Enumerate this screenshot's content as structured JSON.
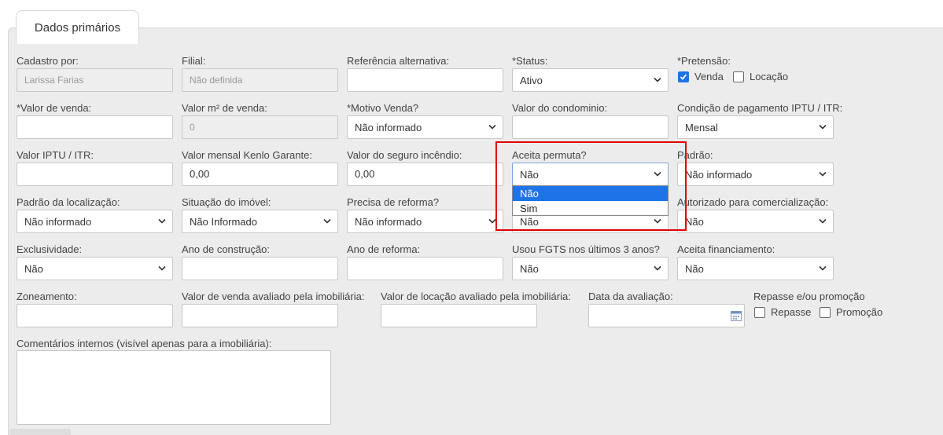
{
  "tab": {
    "label": "Dados primários"
  },
  "rows": [
    [
      {
        "id": "cadastro_por",
        "label": "Cadastro por:",
        "kind": "input-disabled",
        "value": "Larissa Farias"
      },
      {
        "id": "filial",
        "label": "Filial:",
        "kind": "input-disabled",
        "value": "Não definida"
      },
      {
        "id": "referencia_alternativa",
        "label": "Referência alternativa:",
        "kind": "input",
        "value": ""
      },
      {
        "id": "status",
        "label": "*Status:",
        "kind": "select",
        "value": "Ativo"
      },
      {
        "id": "pretensao",
        "label": "*Pretensão:",
        "kind": "checks",
        "options": [
          {
            "label": "Venda",
            "checked": true
          },
          {
            "label": "Locação",
            "checked": false
          }
        ]
      }
    ],
    [
      {
        "id": "valor_venda",
        "label": "*Valor de venda:",
        "kind": "input",
        "value": ""
      },
      {
        "id": "valor_m2_venda",
        "label": "Valor m² de venda:",
        "kind": "input-disabled",
        "value": "0"
      },
      {
        "id": "motivo_venda",
        "label": "*Motivo Venda?",
        "kind": "select",
        "value": "Não informado"
      },
      {
        "id": "valor_condominio",
        "label": "Valor do condominio:",
        "kind": "input",
        "value": ""
      },
      {
        "id": "condicao_pagamento_iptu",
        "label": "Condição de pagamento IPTU / ITR:",
        "kind": "select",
        "value": "Mensal"
      }
    ],
    [
      {
        "id": "valor_iptu",
        "label": "Valor IPTU / ITR:",
        "kind": "input",
        "value": ""
      },
      {
        "id": "valor_kenlo_garante",
        "label": "Valor mensal Kenlo Garante:",
        "kind": "input",
        "value": "0,00"
      },
      {
        "id": "valor_seguro_incendio",
        "label": "Valor do seguro incêndio:",
        "kind": "input",
        "value": "0,00"
      },
      {
        "id": "aceita_permuta",
        "label": "Aceita permuta?",
        "kind": "select",
        "value": "Não",
        "focus": true
      },
      {
        "id": "padrao",
        "label": "Padrão:",
        "kind": "select",
        "value": "Não informado"
      }
    ],
    [
      {
        "id": "padrao_localizacao",
        "label": "Padrão da localização:",
        "kind": "select",
        "value": "Não informado"
      },
      {
        "id": "situacao_imovel",
        "label": "Situação do imóvel:",
        "kind": "select",
        "value": "Não Informado"
      },
      {
        "id": "precisa_reforma",
        "label": "Precisa de reforma?",
        "kind": "select",
        "value": "Não informado"
      },
      {
        "id": "campo_oculto",
        "label": "",
        "kind": "select",
        "value": "Não"
      },
      {
        "id": "autorizado_comercializacao",
        "label": "Autorizado para comercialização:",
        "kind": "select",
        "value": "Não"
      }
    ],
    [
      {
        "id": "exclusividade",
        "label": "Exclusividade:",
        "kind": "select",
        "value": "Não"
      },
      {
        "id": "ano_construcao",
        "label": "Ano de construção:",
        "kind": "input",
        "value": ""
      },
      {
        "id": "ano_reforma",
        "label": "Ano de reforma:",
        "kind": "input",
        "value": ""
      },
      {
        "id": "usou_fgts",
        "label": "Usou FGTS nos últimos 3 anos?",
        "kind": "select",
        "value": "Não"
      },
      {
        "id": "aceita_financiamento",
        "label": "Aceita financiamento:",
        "kind": "select",
        "value": "Não"
      }
    ],
    [
      {
        "id": "zoneamento",
        "label": "Zoneamento:",
        "kind": "input",
        "value": ""
      },
      {
        "id": "valor_venda_avaliado",
        "label": "Valor de venda avaliado pela imobiliária:",
        "kind": "input",
        "value": ""
      },
      {
        "id": "valor_locacao_avaliado",
        "label": "Valor de locação avaliado pela imobiliária:",
        "kind": "input",
        "value": ""
      },
      {
        "id": "data_avaliacao",
        "label": "Data da avaliação:",
        "kind": "date",
        "value": ""
      },
      {
        "id": "repasse_promocao",
        "label": "Repasse e/ou promoção",
        "kind": "checks",
        "options": [
          {
            "label": "Repasse",
            "checked": false
          },
          {
            "label": "Promoção",
            "checked": false
          }
        ]
      }
    ]
  ],
  "comentarios": {
    "label": "Comentários internos (visível apenas para a imobiliária):",
    "value": ""
  },
  "dropdown": {
    "options": [
      {
        "label": "Não",
        "highlighted": true
      },
      {
        "label": "Sim",
        "highlighted": false
      }
    ]
  },
  "colors": {
    "accent": "#1e73e8",
    "highlight_box": "#e00000",
    "panel_bg": "#ececec"
  },
  "icons": {
    "select_arrow": "chevron-down-icon",
    "date_picker": "calendar-icon",
    "checkbox_check": "check-icon"
  }
}
